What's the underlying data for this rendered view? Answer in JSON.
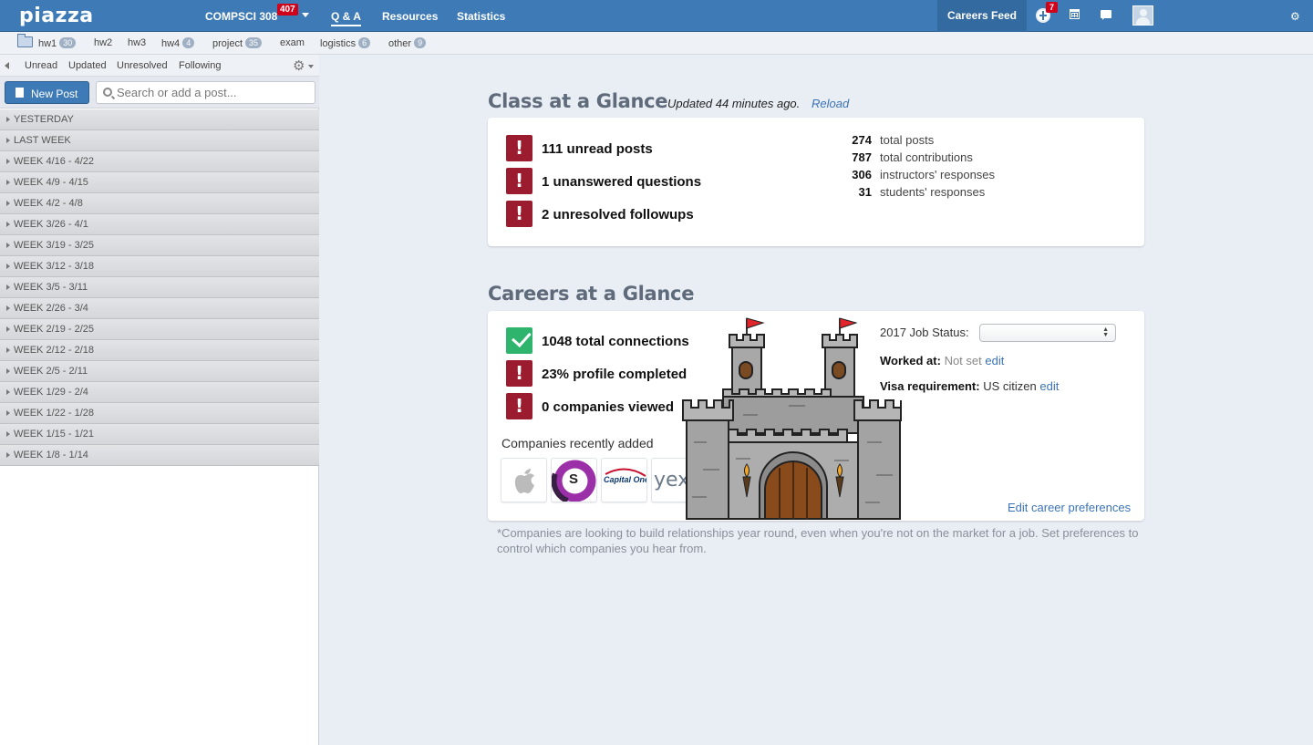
{
  "header": {
    "logo": "piazza",
    "course": "COMPSCI 308",
    "course_badge": "407",
    "nav": [
      "Q & A",
      "Resources",
      "Statistics"
    ],
    "careers_feed": "Careers Feed",
    "notif_count": "7"
  },
  "folders": [
    {
      "name": "hw1",
      "count": "30"
    },
    {
      "name": "hw2",
      "count": ""
    },
    {
      "name": "hw3",
      "count": ""
    },
    {
      "name": "hw4",
      "count": "4"
    },
    {
      "name": "project",
      "count": "35"
    },
    {
      "name": "exam",
      "count": ""
    },
    {
      "name": "logistics",
      "count": "6"
    },
    {
      "name": "other",
      "count": "9"
    }
  ],
  "filters": [
    "Unread",
    "Updated",
    "Unresolved",
    "Following"
  ],
  "sidebar": {
    "new_post": "New Post",
    "search_placeholder": "Search or add a post...",
    "weeks": [
      "YESTERDAY",
      "LAST WEEK",
      "WEEK 4/16 - 4/22",
      "WEEK 4/9 - 4/15",
      "WEEK 4/2 - 4/8",
      "WEEK 3/26 - 4/1",
      "WEEK 3/19 - 3/25",
      "WEEK 3/12 - 3/18",
      "WEEK 3/5 - 3/11",
      "WEEK 2/26 - 3/4",
      "WEEK 2/19 - 2/25",
      "WEEK 2/12 - 2/18",
      "WEEK 2/5 - 2/11",
      "WEEK 1/29 - 2/4",
      "WEEK 1/22 - 1/28",
      "WEEK 1/15 - 1/21",
      "WEEK 1/8 - 1/14"
    ]
  },
  "class_glance": {
    "title": "Class at a Glance",
    "updated": "Updated  44 minutes ago.",
    "reload": "Reload",
    "alerts": [
      "111 unread posts",
      "1 unanswered questions",
      "2 unresolved followups"
    ],
    "stats": [
      {
        "num": "274",
        "label": "total posts"
      },
      {
        "num": "787",
        "label": "total contributions"
      },
      {
        "num": "306",
        "label": "instructors' responses"
      },
      {
        "num": "31",
        "label": "students' responses"
      }
    ]
  },
  "careers_glance": {
    "title": "Careers at a Glance",
    "items": [
      "1048 total connections",
      "23% profile completed",
      "0 companies viewed"
    ],
    "companies_label": "Companies recently added",
    "companies": [
      "apple-logo",
      "S",
      "Capital One",
      "yex"
    ],
    "job_status_label": "2017 Job Status:",
    "worked_at_label": "Worked at:",
    "worked_at_value": "Not set",
    "visa_label": "Visa requirement:",
    "visa_value": "US citizen",
    "edit": "edit",
    "edit_prefs": "Edit career preferences",
    "footnote": "*Companies are looking to build relationships year round, even when you're not on the market for a job. Set preferences to control which companies you hear from."
  }
}
